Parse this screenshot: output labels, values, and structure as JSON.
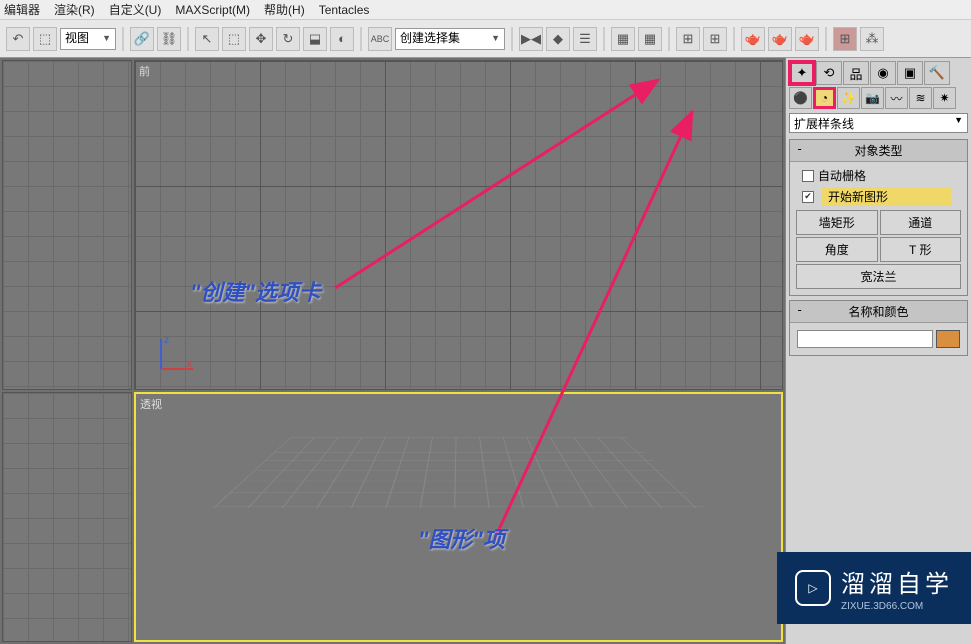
{
  "menu": {
    "editor": "编辑器",
    "render": "渲染(R)",
    "customize": "自定义(U)",
    "maxscript": "MAXScript(M)",
    "help": "帮助(H)",
    "tentacles": "Tentacles"
  },
  "toolbar": {
    "view_dropdown": "视图",
    "selection_set": "创建选择集"
  },
  "viewports": {
    "top_left": "",
    "top_right": "前",
    "bottom_left": "",
    "bottom_right": "透视",
    "axis_x": "x",
    "axis_z": "z"
  },
  "command_panel": {
    "category_dropdown": "扩展样条线",
    "object_type_header": "对象类型",
    "auto_grid_label": "自动栅格",
    "start_new_shape_label": "开始新图形",
    "buttons": {
      "wall_rect": "墙矩形",
      "channel": "通道",
      "angle": "角度",
      "tee": "T 形",
      "wide_flange": "宽法兰"
    },
    "name_color_header": "名称和颜色"
  },
  "annotations": {
    "create_tab": "\"创建\"选项卡",
    "shape_item": "\"图形\"项"
  },
  "icons": {
    "undo": "↶",
    "link": "⛓",
    "select": "⬚",
    "move": "✥",
    "rotate": "↻",
    "scale": "⬓",
    "snap": "⊞",
    "mirror": "⇄",
    "align": "≡",
    "layers": "▦",
    "material": "◉",
    "render": "🫖",
    "create": "✦",
    "modify": "⟲",
    "hierarchy": "品",
    "motion": "◉",
    "display": "▣",
    "utilities": "🔨",
    "geometry": "⚫",
    "shapes": "◔",
    "lights": "☀",
    "cameras": "📷",
    "helpers": "〰",
    "space_warps": "≋",
    "systems": "⚙"
  },
  "watermark": {
    "brand": "溜溜自学",
    "url": "ZIXUE.3D66.COM",
    "play": "▷"
  }
}
